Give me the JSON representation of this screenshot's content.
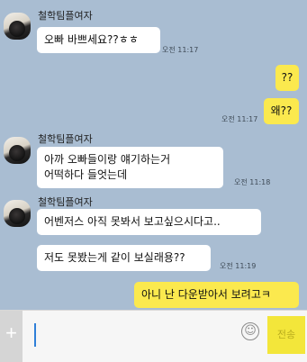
{
  "messages": [
    {
      "type": "in",
      "sender": "철학팀플여자",
      "text": "오빠 바쁘세요??ㅎㅎ",
      "time": "오전 11:17"
    },
    {
      "type": "out",
      "text": "??"
    },
    {
      "type": "out",
      "text": "왜??",
      "time": "오전 11:17"
    },
    {
      "type": "in",
      "sender": "철학팀플여자",
      "text": "아까 오빠들이랑 얘기하는거\n어떡하다 들엇는데",
      "time": "오전 11:18"
    },
    {
      "type": "in",
      "sender": "철학팀플여자",
      "text": "어벤저스 아직 못봐서 보고싶으시다고.."
    },
    {
      "type": "in",
      "text": "저도 못봤는게 같이 보실래용??",
      "time": "오전 11:19"
    },
    {
      "type": "out",
      "text": "아니 난 다운받아서 보려고ㅋ"
    }
  ],
  "input": {
    "plus_label": "+",
    "emoji_label": "☺",
    "send_label": "전송"
  },
  "colors": {
    "background": "#a9bdd2",
    "incoming_bubble": "#ffffff",
    "outgoing_bubble": "#fbe94e",
    "send_button": "#f3e63a"
  }
}
